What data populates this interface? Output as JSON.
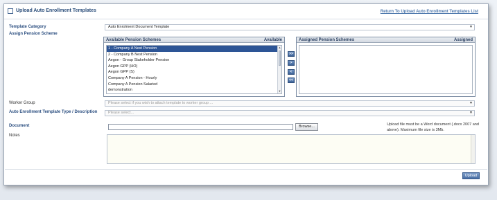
{
  "header": {
    "title": "Upload Auto Enrollment Templates",
    "return_link": "Return To Upload Auto Enrollment Templates List"
  },
  "labels": {
    "template_category": "Template Category",
    "assign_pension_scheme": "Assign Pension Scheme",
    "worker_group": "Worker Group",
    "template_type": "Auto Enrollment Template Type / Description",
    "document": "Document",
    "notes": "Notes"
  },
  "template_category": {
    "value": "Auto Enrolment Document Template"
  },
  "available": {
    "header": "Available Pension Schemes",
    "header_right": "Available",
    "items": [
      {
        "label": "1 - Company A Nest Pension",
        "selected": true
      },
      {
        "label": "2 - Company B Nest Pension",
        "selected": false
      },
      {
        "label": "Aegon - Group Stakeholder Pension",
        "selected": false
      },
      {
        "label": "Aegon GPP (HO)",
        "selected": false
      },
      {
        "label": "Aegon GPP (S)",
        "selected": false
      },
      {
        "label": "Company A Pension - Hourly",
        "selected": false
      },
      {
        "label": "Company A Pension Salaried",
        "selected": false
      },
      {
        "label": "demonstration",
        "selected": false
      },
      {
        "label": "demonstration pension",
        "selected": false
      }
    ]
  },
  "assigned": {
    "header": "Assigned Pension Schemes",
    "header_right": "Assigned"
  },
  "move_buttons": {
    "add_all": ">>",
    "add": ">",
    "remove": "<",
    "remove_all": "<<"
  },
  "worker_group": {
    "placeholder": "Please select if you wish to attach template to worker group ..."
  },
  "template_type": {
    "placeholder": "Please select..."
  },
  "document": {
    "browse_label": "Browse...",
    "help_text": "Upload file must be a Word document (.docx 2007 and above). Maximum file size is 3Mb."
  },
  "actions": {
    "upload_label": "Upload"
  }
}
